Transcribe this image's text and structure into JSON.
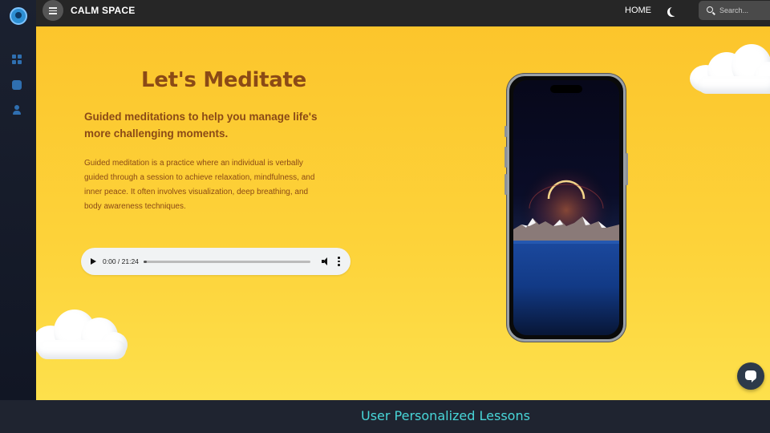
{
  "header": {
    "brand": "CALM SPACE",
    "home_label": "HOME",
    "search_placeholder": "Search..."
  },
  "hero": {
    "title": "Let's Meditate",
    "subtitle": "Guided meditations to help you manage life's more challenging moments.",
    "paragraph": "Guided meditation is a practice where an individual is verbally guided through a session to achieve relaxation, mindfulness, and inner peace. It often involves visualization, deep breathing, and body awareness techniques."
  },
  "audio_player": {
    "time": "0:00 / 21:24",
    "progress": 0
  },
  "caption": "User Personalized Lessons",
  "icons": {
    "sidebar": [
      "app-logo-icon",
      "grid-icon",
      "puzzle-icon",
      "user-icon"
    ],
    "header": [
      "menu-icon",
      "moon-icon",
      "search-icon"
    ],
    "player": [
      "play-icon",
      "volume-icon",
      "more-options-icon"
    ],
    "chat": "chat-icon"
  },
  "colors": {
    "background": "#fcc52c",
    "heading": "#8b4a16",
    "topbar": "#262626",
    "caption": "#48d6d8"
  }
}
